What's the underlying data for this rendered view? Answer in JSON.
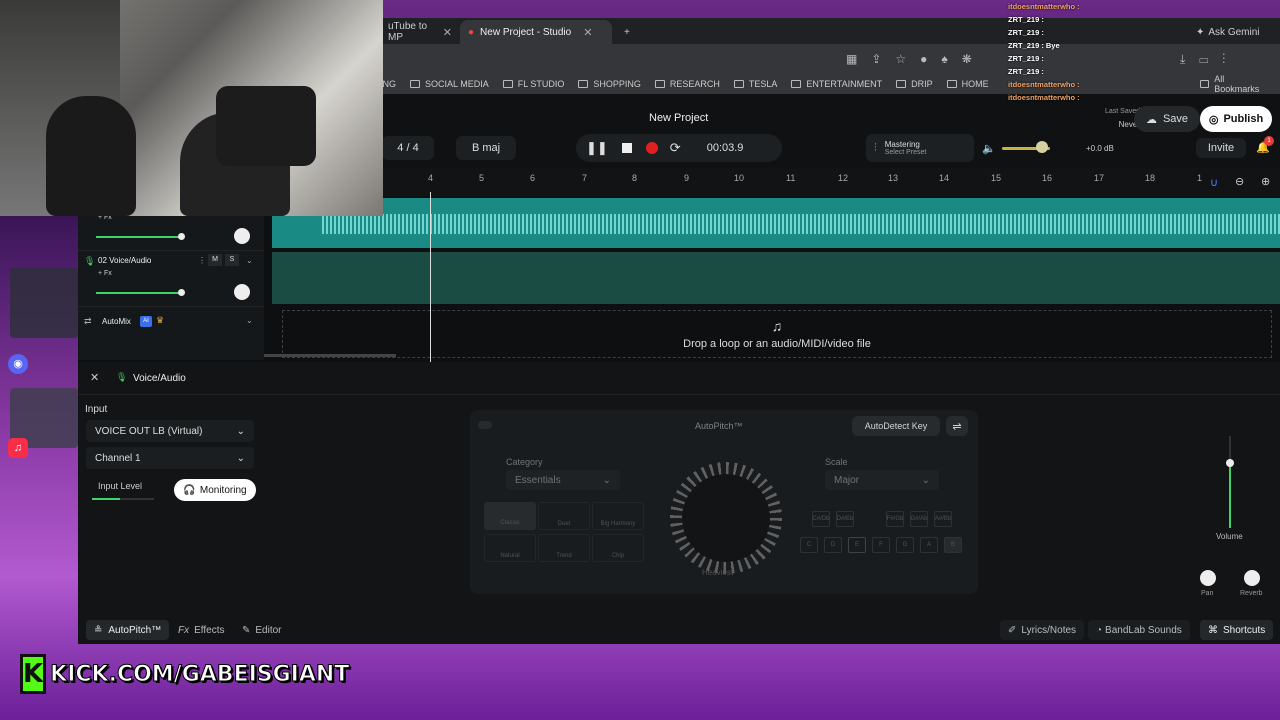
{
  "browser": {
    "tabs": [
      {
        "label": "uTube to MP"
      },
      {
        "label": "New Project - Studio"
      }
    ],
    "gemini": "Ask Gemini",
    "bookmarks": [
      "ING",
      "SOCIAL MEDIA",
      "FL STUDIO",
      "SHOPPING",
      "RESEARCH",
      "TESLA",
      "ENTERTAINMENT",
      "DRIP",
      "HOME"
    ],
    "all_bookmarks": "All Bookmarks"
  },
  "chat": [
    {
      "user": "itdoesntmatterwho :",
      "msg": ""
    },
    {
      "user": "ZRT_219 :",
      "msg": ""
    },
    {
      "user": "ZRT_219 :",
      "msg": ""
    },
    {
      "user": "ZRT_219 :",
      "msg": "Bye"
    },
    {
      "user": "ZRT_219 :",
      "msg": ""
    },
    {
      "user": "ZRT_219 :",
      "msg": ""
    },
    {
      "user": "itdoesntmatterwho :",
      "msg": ""
    },
    {
      "user": "itdoesntmatterwho :",
      "msg": ""
    }
  ],
  "app": {
    "project_title": "New Project",
    "last_saved_label": "Last Saved",
    "last_saved_value": "Never",
    "save": "Save",
    "publish": "Publish",
    "time_sig": "4 / 4",
    "key": "B maj",
    "time": "00:03.9",
    "mastering_title": "Mastering",
    "mastering_sub": "Select Preset",
    "volume_db": "+0.0 dB",
    "invite": "Invite",
    "notif_count": "1",
    "ruler": [
      "4",
      "5",
      "6",
      "7",
      "8",
      "9",
      "10",
      "11",
      "12",
      "13",
      "14",
      "15",
      "16",
      "17",
      "18",
      "1"
    ],
    "tracks": [
      {
        "fx": "+ Fx"
      },
      {
        "name": "02  Voice/Audio",
        "m": "M",
        "s": "S",
        "fx": "+ Fx"
      }
    ],
    "automix": "AutoMix",
    "ai_badge": "AI",
    "drop_text": "Drop a loop or an audio/MIDI/video file"
  },
  "panel": {
    "title": "Voice/Audio",
    "input_label": "Input",
    "input_device": "VOICE OUT LB (Virtual)",
    "channel": "Channel 1",
    "input_level": "Input Level",
    "monitoring": "Monitoring",
    "autopitch_title": "AutoPitch™",
    "autodetect": "AutoDetect Key",
    "category_label": "Category",
    "category_value": "Essentials",
    "scale_label": "Scale",
    "scale_value": "Major",
    "styles": [
      "Classic",
      "Duet",
      "Big Harmony",
      "Natural",
      "Trend",
      "Chip"
    ],
    "amount": "Heaviest",
    "keys_top": [
      "C#/Db",
      "D#/Eb",
      "F#/Gb",
      "G#/Ab",
      "A#/Bb"
    ],
    "keys_bottom": [
      "C",
      "D",
      "E",
      "F",
      "G",
      "A",
      "B"
    ],
    "volume": "Volume",
    "pan": "Pan",
    "reverb": "Reverb"
  },
  "bottom": {
    "autopitch": "AutoPitch™",
    "effects": "Effects",
    "editor": "Editor",
    "lyrics": "Lyrics/Notes",
    "bandlab": "BandLab Sounds",
    "shortcuts": "Shortcuts"
  },
  "overlay": {
    "kick_url": "KICK.COM/GABEISGIANT",
    "kick_letter": "K"
  }
}
